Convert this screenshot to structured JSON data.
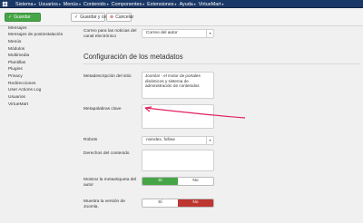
{
  "topbar": {
    "menu": [
      {
        "label": "Sistema"
      },
      {
        "label": "Usuarios"
      },
      {
        "label": "Menús"
      },
      {
        "label": "Contenido"
      },
      {
        "label": "Componentes"
      },
      {
        "label": "Extensiones"
      },
      {
        "label": "Ayuda"
      },
      {
        "label": "VirtueMart"
      }
    ]
  },
  "toolbar": {
    "save_label": "Guardar",
    "save_close_label": "Guardar y cerrar",
    "cancel_label": "Cancelar"
  },
  "sidebar": {
    "items": [
      {
        "label": "Mensajes"
      },
      {
        "label": "Mensajes de postinstalación"
      },
      {
        "label": "Menús"
      },
      {
        "label": "Módulos"
      },
      {
        "label": "Multimedia"
      },
      {
        "label": "Plantillas"
      },
      {
        "label": "Plugins"
      },
      {
        "label": "Privacy"
      },
      {
        "label": "Redirecciones"
      },
      {
        "label": "User Actions Log"
      },
      {
        "label": "Usuarios"
      },
      {
        "label": "VirtueMart"
      }
    ]
  },
  "form": {
    "email_policy_label": "Correo para las noticias del canal electrónico",
    "email_policy_value": "Correo del autor",
    "section_title": "Configuración de los metadatos",
    "meta_description_label": "Metadescripción del sitio",
    "meta_description_value": "Joomla! - el motor de portales dinámicos y sistema de administración de contenidos",
    "meta_keywords_label": "Metapalabras clave",
    "meta_keywords_value": "",
    "robots_label": "Robots",
    "robots_value": "noindex, follow",
    "content_rights_label": "Derechos del contenido",
    "content_rights_value": "",
    "show_author_label": "Mostrar la metaetiqueta del autor",
    "show_author_options": [
      "Sí",
      "No"
    ],
    "show_author_selected": "Sí",
    "show_version_label": "Muestra la versión de Joomla.",
    "show_version_options": [
      "Sí",
      "No"
    ],
    "show_version_selected": "No"
  },
  "colors": {
    "topbar": "#1a3867",
    "save_green": "#46a546",
    "no_red": "#bd362f",
    "annotation_arrow": "#e0245e"
  }
}
